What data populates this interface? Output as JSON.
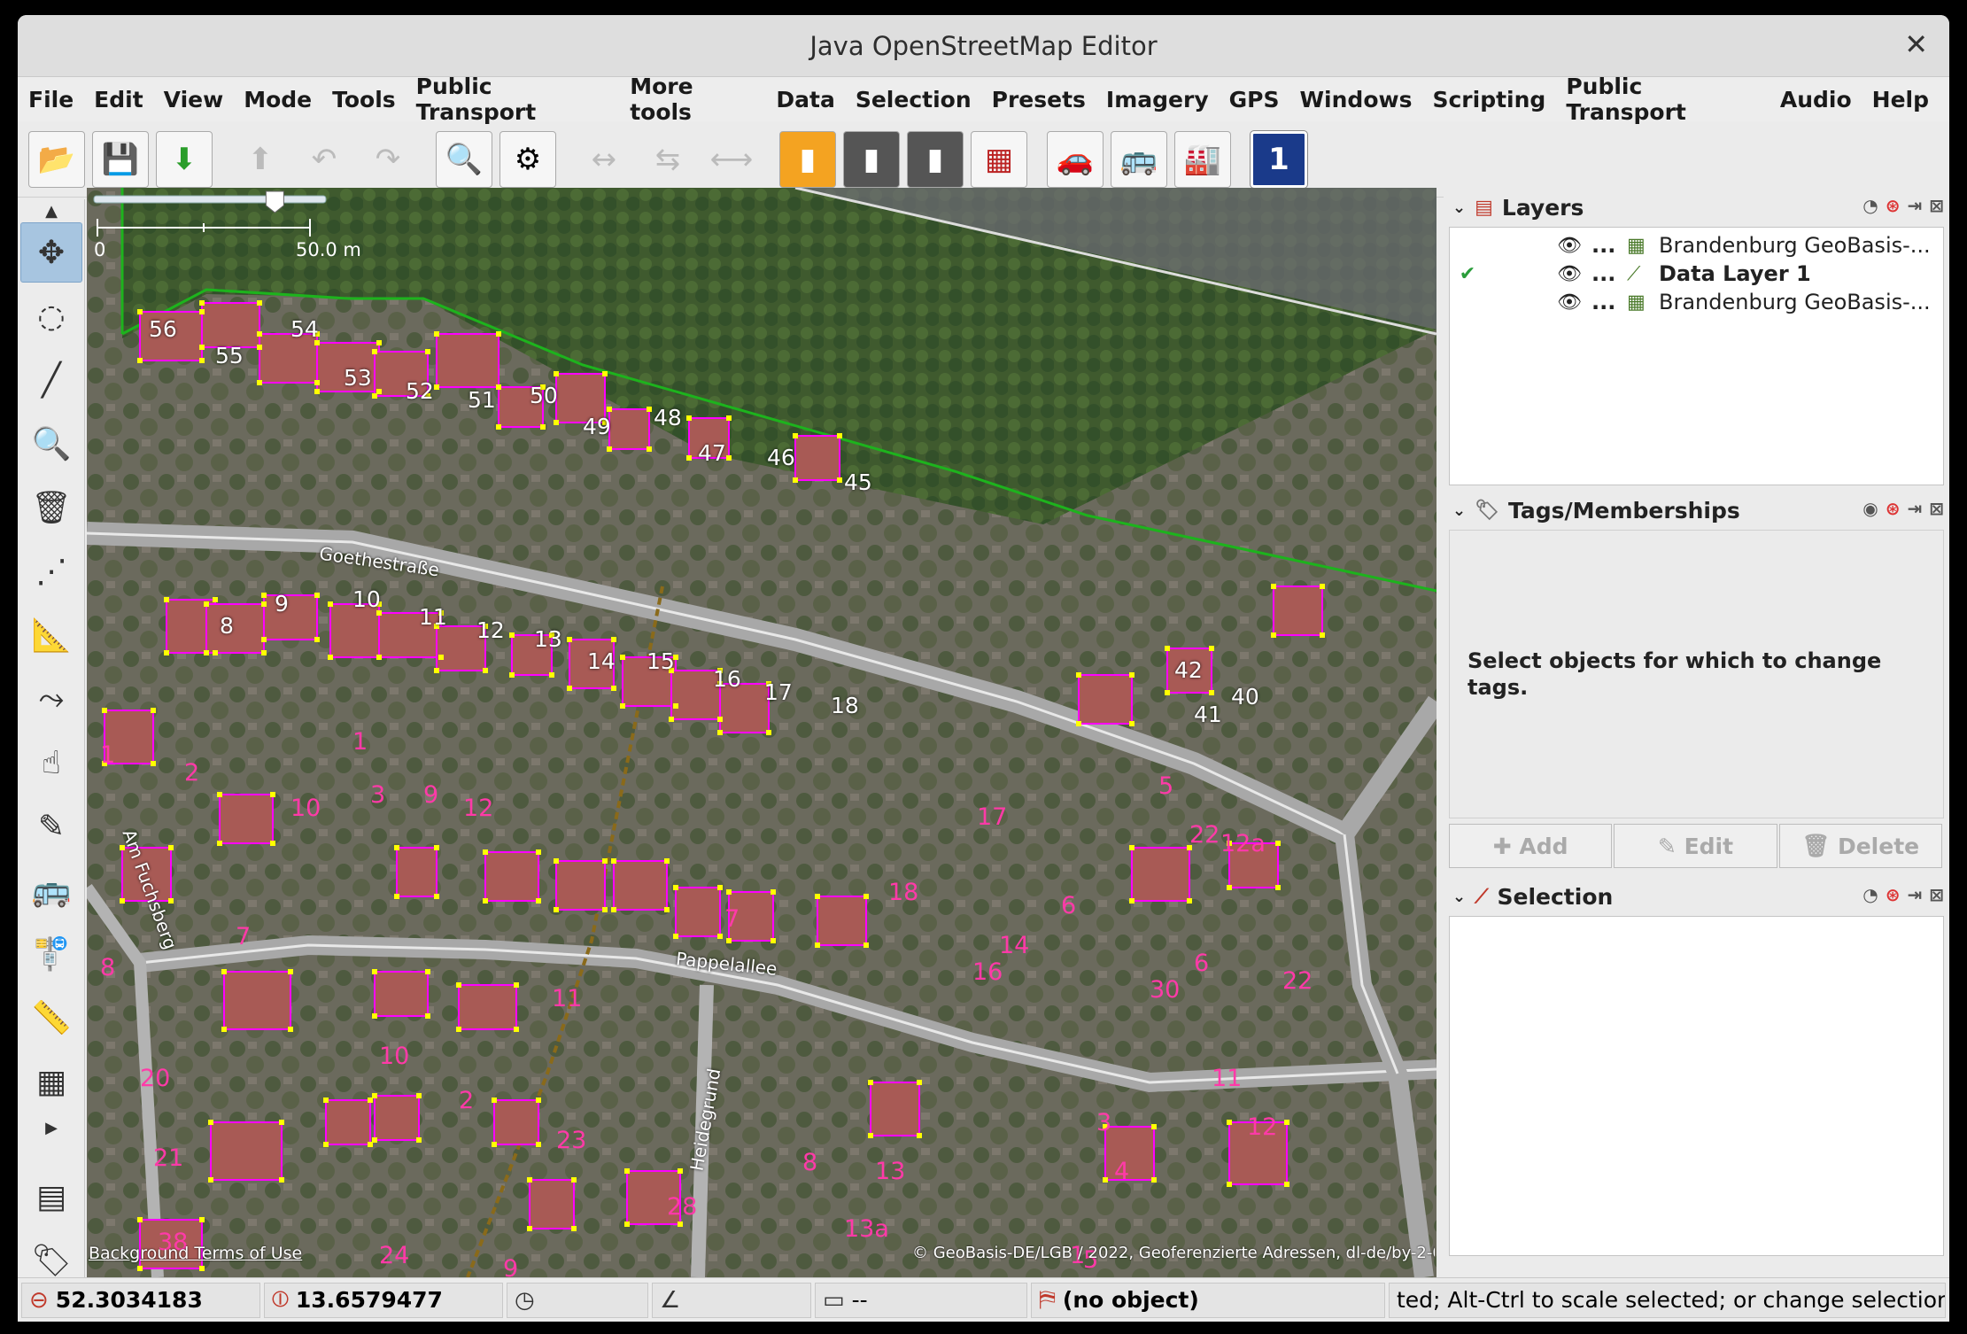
{
  "window": {
    "title": "Java OpenStreetMap Editor",
    "close_icon": "close-icon"
  },
  "menu": [
    "File",
    "Edit",
    "View",
    "Mode",
    "Tools",
    "Public Transport",
    "More tools",
    "Data",
    "Selection",
    "Presets",
    "Imagery",
    "GPS",
    "Windows",
    "Scripting",
    "Public Transport",
    "Audio",
    "Help"
  ],
  "toolbar": [
    {
      "name": "open-icon",
      "glyph": "📂",
      "state": "enabled"
    },
    {
      "name": "save-icon",
      "glyph": "💾",
      "state": "enabled"
    },
    {
      "name": "download-icon",
      "glyph": "⬇",
      "state": "enabled"
    },
    {
      "name": "upload-icon",
      "glyph": "⬆",
      "state": "disabled"
    },
    {
      "name": "undo-icon",
      "glyph": "↶",
      "state": "disabled"
    },
    {
      "name": "redo-icon",
      "glyph": "↷",
      "state": "disabled"
    },
    {
      "name": "zoom-icon",
      "glyph": "🔍",
      "state": "enabled"
    },
    {
      "name": "preferences-icon",
      "glyph": "⚙",
      "state": "enabled"
    },
    {
      "name": "split-way-icon",
      "glyph": "↔",
      "state": "disabled"
    },
    {
      "name": "combine-way-icon",
      "glyph": "⇆",
      "state": "disabled"
    },
    {
      "name": "reverse-way-icon",
      "glyph": "⟷",
      "state": "disabled"
    },
    {
      "name": "preset-road-icon",
      "glyph": "▮",
      "state": "enabled"
    },
    {
      "name": "preset-track-icon",
      "glyph": "▮",
      "state": "enabled"
    },
    {
      "name": "preset-node-road-icon",
      "glyph": "▮",
      "state": "enabled"
    },
    {
      "name": "preset-wall-icon",
      "glyph": "▦",
      "state": "enabled"
    },
    {
      "name": "preset-car-icon",
      "glyph": "🚗",
      "state": "enabled"
    },
    {
      "name": "preset-bus-icon",
      "glyph": "🚌",
      "state": "enabled"
    },
    {
      "name": "preset-industrial-icon",
      "glyph": "🏭",
      "state": "enabled"
    },
    {
      "name": "preset-route-1-icon",
      "glyph": "1",
      "state": "enabled"
    }
  ],
  "left_tools": [
    {
      "name": "select-mode-icon",
      "glyph": "✥",
      "active": true
    },
    {
      "name": "lasso-mode-icon",
      "glyph": "◌",
      "active": false
    },
    {
      "name": "draw-mode-icon",
      "glyph": "╱",
      "active": false
    },
    {
      "name": "zoom-mode-icon",
      "glyph": "🔍",
      "active": false
    },
    {
      "name": "delete-mode-icon",
      "glyph": "🗑",
      "active": false
    },
    {
      "name": "improve-way-mode-icon",
      "glyph": "⋰",
      "active": false
    },
    {
      "name": "parallel-mode-icon",
      "glyph": "📐",
      "active": false
    },
    {
      "name": "extrude-mode-icon",
      "glyph": "⤳",
      "active": false
    },
    {
      "name": "add-node-mode-icon",
      "glyph": "☝",
      "active": false
    },
    {
      "name": "pencil-mode-icon",
      "glyph": "✎",
      "active": false
    },
    {
      "name": "bus-stop-icon",
      "glyph": "🚌",
      "active": false
    },
    {
      "name": "bus-route-icon",
      "glyph": "🚏",
      "active": false
    },
    {
      "name": "measure-icon",
      "glyph": "📏",
      "active": false
    },
    {
      "name": "building-icon",
      "glyph": "▦",
      "active": false
    }
  ],
  "map": {
    "scale_label_min": "0",
    "scale_label_max": "50.0 m",
    "zoom_slider_fraction": 0.78,
    "streets": [
      {
        "name": "street-goethestrasse",
        "text": "Goethestraße"
      },
      {
        "name": "street-pappelallee",
        "text": "Pappelallee"
      },
      {
        "name": "street-heidegrund",
        "text": "Heidegrund"
      },
      {
        "name": "street-am-fuchsberg",
        "text": "Am Fuchsberg"
      }
    ],
    "house_numbers_white": [
      "56",
      "55",
      "54",
      "53",
      "52",
      "51",
      "50",
      "49",
      "48",
      "47",
      "46",
      "45",
      "8",
      "9",
      "10",
      "11",
      "12",
      "13",
      "14",
      "15",
      "16",
      "17",
      "18",
      "42",
      "40",
      "41"
    ],
    "house_numbers_pink": [
      "1",
      "2",
      "3",
      "7",
      "8",
      "9",
      "10",
      "1",
      "2",
      "3",
      "4",
      "5",
      "6",
      "7",
      "8",
      "9",
      "10",
      "11",
      "12",
      "20",
      "21",
      "22",
      "23",
      "24",
      "22",
      "12a",
      "13",
      "13a",
      "14",
      "5",
      "6",
      "11",
      "12",
      "17",
      "18",
      "16",
      "28",
      "38",
      "30",
      "1"
    ],
    "attribution_left": "Background Terms of Use",
    "attribution_right": "© GeoBasis-DE/LGB / 2022, Geoferenzierte Adressen, dl-de/by-2-0"
  },
  "layers_panel": {
    "title": "Layers",
    "rows": [
      {
        "checked": false,
        "visible_icon": "eye-icon",
        "dots": "...",
        "label": "Brandenburg GeoBasis-...",
        "bold": false,
        "type_icon": "imagery-grid-icon"
      },
      {
        "checked": true,
        "visible_icon": "eye-icon",
        "dots": "...",
        "label": "Data Layer 1",
        "bold": true,
        "type_icon": "data-layer-icon"
      },
      {
        "checked": false,
        "visible_icon": "eye-icon",
        "dots": "...",
        "label": "Brandenburg GeoBasis-...",
        "bold": false,
        "type_icon": "imagery-grid-icon"
      }
    ]
  },
  "tags_panel": {
    "title": "Tags/Memberships",
    "empty_text": "Select objects for which to change tags.",
    "buttons": [
      "Add",
      "Edit",
      "Delete"
    ]
  },
  "selection_panel": {
    "title": "Selection"
  },
  "status": {
    "lat": "52.3034183",
    "lon": "13.6579477",
    "heading": "",
    "angle": "",
    "length": "--",
    "object": "(no object)",
    "help": "ted; Alt-Ctrl to scale selected; or change selection"
  },
  "colors": {
    "selected_way": "#ffff00",
    "node": "#ffff00",
    "area_outline": "#ff00ff",
    "boundary": "#00c000",
    "accent": "#3c6ea8"
  }
}
